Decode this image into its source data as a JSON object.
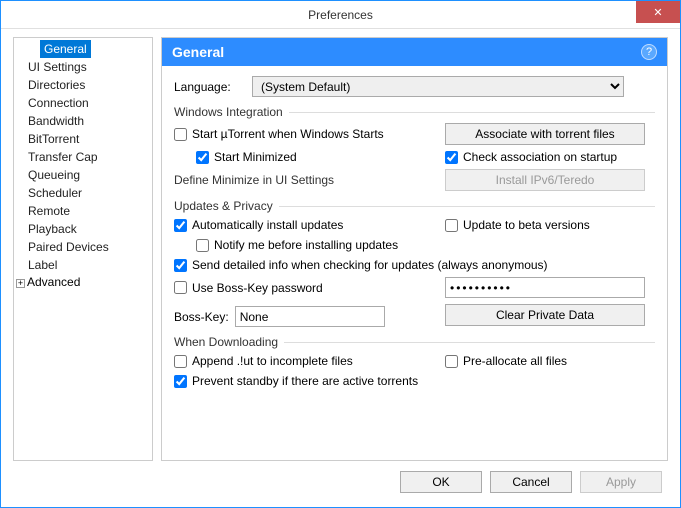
{
  "window": {
    "title": "Preferences"
  },
  "sidebar": {
    "items": [
      {
        "label": "General",
        "selected": true
      },
      {
        "label": "UI Settings"
      },
      {
        "label": "Directories"
      },
      {
        "label": "Connection"
      },
      {
        "label": "Bandwidth"
      },
      {
        "label": "BitTorrent"
      },
      {
        "label": "Transfer Cap"
      },
      {
        "label": "Queueing"
      },
      {
        "label": "Scheduler"
      },
      {
        "label": "Remote"
      },
      {
        "label": "Playback"
      },
      {
        "label": "Paired Devices"
      },
      {
        "label": "Label"
      },
      {
        "label": "Advanced",
        "expandable": true
      }
    ]
  },
  "header": {
    "title": "General",
    "help": "?"
  },
  "language": {
    "label": "Language:",
    "value": "(System Default)"
  },
  "windows_integration": {
    "legend": "Windows Integration",
    "start_with_windows": "Start µTorrent when Windows Starts",
    "start_minimized": "Start Minimized",
    "define_minimize": "Define Minimize in UI Settings",
    "associate_btn": "Associate with torrent files",
    "check_association": "Check association on startup",
    "install_ipv6_btn": "Install IPv6/Teredo"
  },
  "updates_privacy": {
    "legend": "Updates & Privacy",
    "auto_install": "Automatically install updates",
    "update_beta": "Update to beta versions",
    "notify_before": "Notify me before installing updates",
    "send_detailed": "Send detailed info when checking for updates (always anonymous)",
    "boss_key_pwd": "Use Boss-Key password",
    "pwd_value": "••••••••••",
    "boss_key_label": "Boss-Key:",
    "boss_key_value": "None",
    "clear_data_btn": "Clear Private Data"
  },
  "when_downloading": {
    "legend": "When Downloading",
    "append_ut": "Append .!ut to incomplete files",
    "pre_allocate": "Pre-allocate all files",
    "prevent_standby": "Prevent standby if there are active torrents"
  },
  "footer": {
    "ok": "OK",
    "cancel": "Cancel",
    "apply": "Apply"
  }
}
